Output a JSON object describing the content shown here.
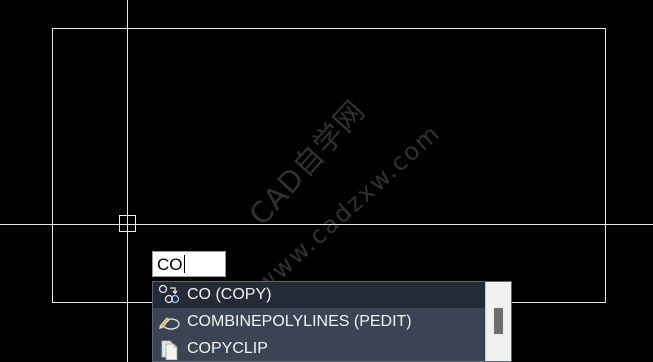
{
  "viewport": {
    "background": "#000000",
    "line_color": "#e6e6e6"
  },
  "watermark": {
    "line1": "CAD自学网",
    "line2": "www.cadzxw.com"
  },
  "command_input": {
    "value": "CO"
  },
  "autocomplete": {
    "items": [
      {
        "label": "CO (COPY)",
        "icon": "copy-icon",
        "selected": true
      },
      {
        "label": "COMBINEPOLYLINES (PEDIT)",
        "icon": "pedit-icon",
        "selected": false
      },
      {
        "label": "COPYCLIP",
        "icon": "copyclip-icon",
        "selected": false
      }
    ],
    "colors": {
      "list_bg": "#3b4453",
      "selected_bg": "#252b36",
      "text": "#f2f2f2"
    }
  }
}
